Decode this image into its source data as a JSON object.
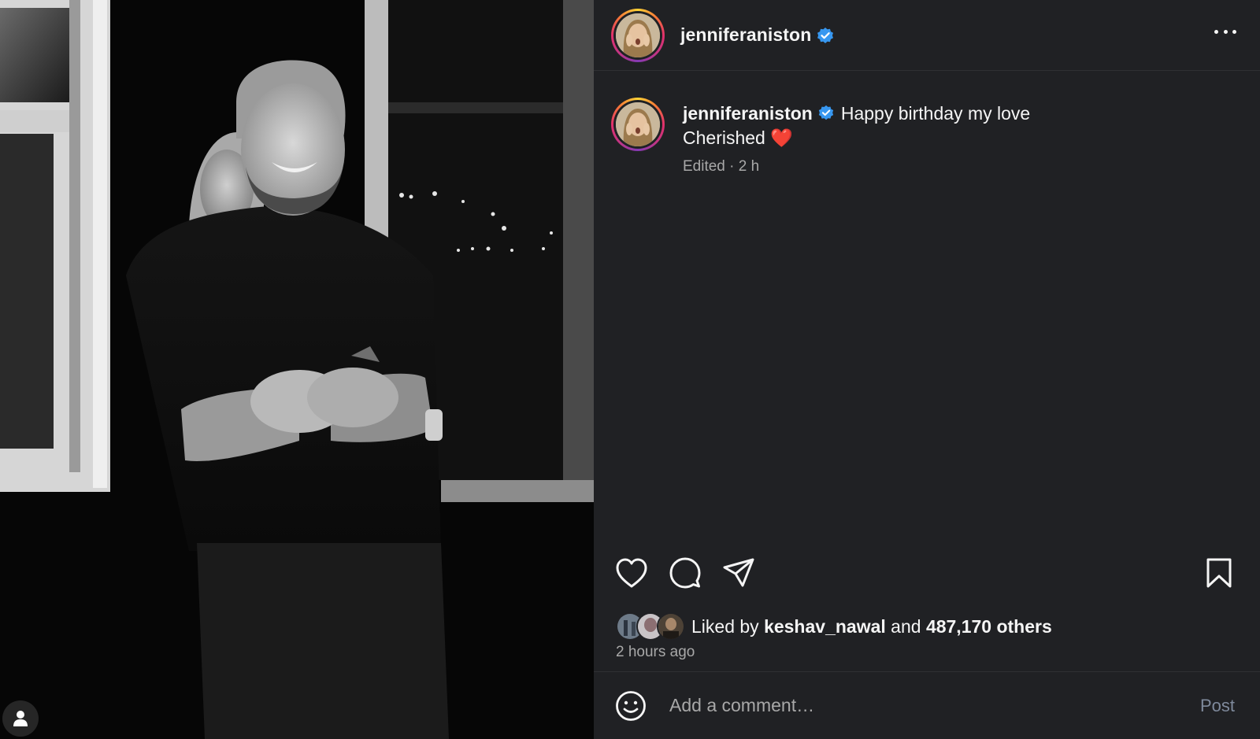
{
  "post": {
    "username": "jenniferaniston",
    "verified": true,
    "caption_text": "Happy birthday my love",
    "caption_line2": "Cherished",
    "caption_emoji": "❤️",
    "edited_label": "Edited",
    "separator": " · ",
    "caption_age": "2 h",
    "liked_by_prefix": "Liked by ",
    "liked_by_user": "keshav_nawal",
    "liked_by_and": " and ",
    "liked_by_others": "487,170 others",
    "posted_ago": "2 hours ago"
  },
  "icons": {
    "more": "more-horizontal-icon",
    "like": "heart-icon",
    "comment": "comment-bubble-icon",
    "share": "paper-plane-icon",
    "save": "bookmark-icon",
    "emoji": "smiley-icon",
    "tag": "person-icon",
    "verified": "verified-badge-icon"
  },
  "comment_box": {
    "placeholder": "Add a comment…",
    "post_label": "Post"
  },
  "colors": {
    "panel_bg": "#202124",
    "verified_blue": "#3797f0",
    "secondary_text": "#a8a8a8",
    "heart_red": "#e8312f"
  }
}
